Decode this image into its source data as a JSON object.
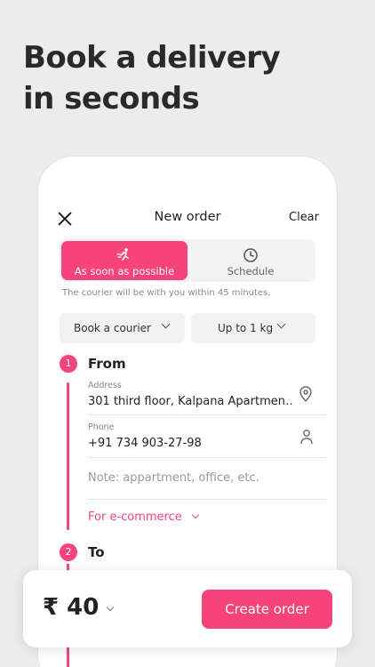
{
  "headline": {
    "line1": "Book a delivery",
    "line2": "in seconds"
  },
  "header": {
    "title": "New order",
    "clear_label": "Clear"
  },
  "timing": {
    "options": [
      {
        "label": "As soon as possible",
        "icon": "running-courier-icon",
        "selected": true
      },
      {
        "label": "Schedule",
        "icon": "clock-icon",
        "selected": false
      }
    ],
    "hint": "The courier will be with you within 45 minutes."
  },
  "selectors": {
    "service": "Book a courier",
    "weight": "Up to 1 kg"
  },
  "from": {
    "step": "1",
    "title": "From",
    "address_label": "Address",
    "address_value": "301 third floor, Kalpana Apartmen…",
    "phone_label": "Phone",
    "phone_value": "+91 734 903-27-98",
    "note_placeholder": "Note: appartment, office, etc.",
    "ecommerce_link": "For e-commerce"
  },
  "to": {
    "step": "2",
    "title": "To"
  },
  "footer": {
    "price": "₹ 40",
    "create_label": "Create order"
  },
  "colors": {
    "accent": "#f6437b",
    "background": "#ececec"
  }
}
